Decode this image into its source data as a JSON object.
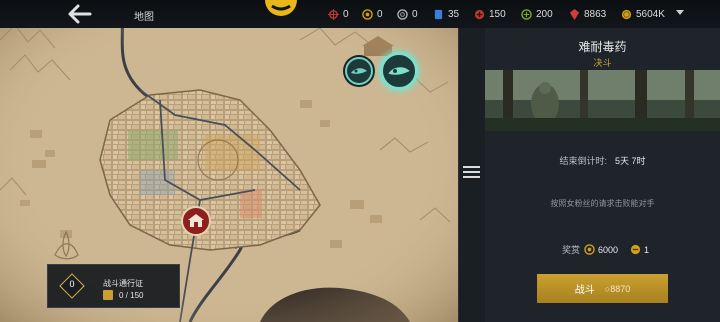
{
  "header": {
    "title": "地图",
    "resources": [
      {
        "icon": "crosshair-icon",
        "value": "0",
        "color": "#c0392b"
      },
      {
        "icon": "coin-ring-icon",
        "value": "0",
        "color": "#d4a017"
      },
      {
        "icon": "grey-token-icon",
        "value": "0",
        "color": "#aeb6bd"
      },
      {
        "icon": "blue-card-icon",
        "value": "35",
        "color": "#3b7dd8"
      },
      {
        "icon": "red-token-icon",
        "value": "150",
        "color": "#c0392b"
      },
      {
        "icon": "green-token-icon",
        "value": "200",
        "color": "#7cab33"
      },
      {
        "icon": "red-gem-icon",
        "value": "8863",
        "color": "#d23c3c"
      },
      {
        "icon": "gold-coin-icon",
        "value": "5604K",
        "color": "#d4a017"
      }
    ]
  },
  "event": {
    "title": "难耐毒药",
    "subtitle": "决斗",
    "countdown_label": "结束倒计时:",
    "countdown_value": "5天 7时",
    "description": "按照女粉丝的请求击败能对手",
    "reward_label": "奖赏",
    "reward_coins": "6000",
    "reward_tokens": "1",
    "fight_label": "战斗",
    "fight_cost": "8870"
  },
  "battle_pass": {
    "level": "0",
    "title": "战斗通行证",
    "progress": "0 / 150"
  },
  "colors": {
    "accent_gold": "#c9a030",
    "panel_bg": "#1e2429",
    "map_paper": "#cdb792"
  }
}
